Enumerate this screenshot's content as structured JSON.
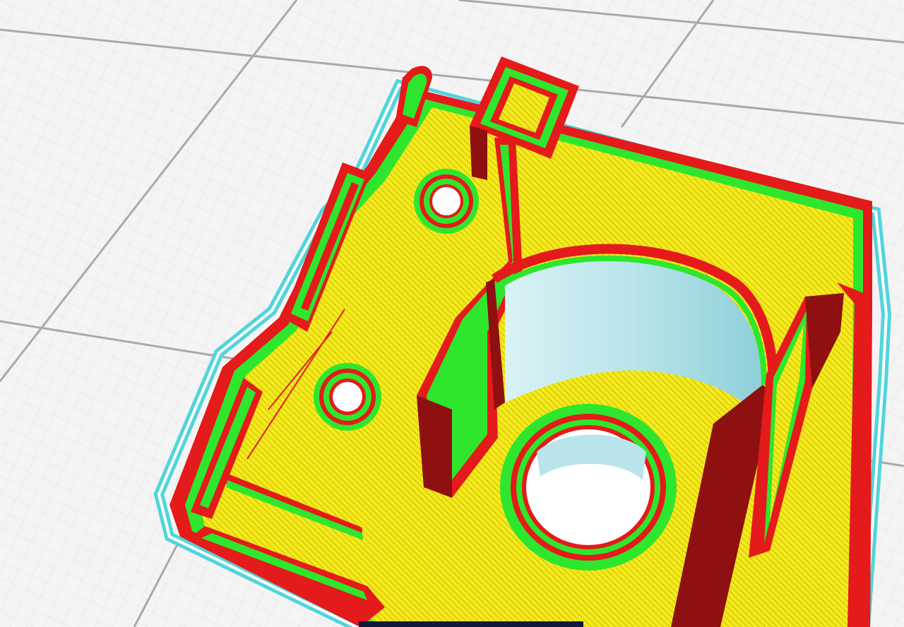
{
  "viewport": {
    "kind": "slicer-layer-preview",
    "background_color": "#f4f4f4",
    "grid": {
      "minor_color": "#e2e2e2",
      "major_color": "#a9a9a9",
      "visible": true
    }
  },
  "colors": {
    "skirt": "#52d4dc",
    "outer_wall": "#e51a1a",
    "outer_wall_shadow": "#8f1010",
    "inner_wall": "#2ee62e",
    "infill": "#f4ea1c",
    "infill_line": "#b9a800",
    "support_cylinder": "#b8e4ea",
    "hole_background": "#ffffff",
    "bottom_toolbar": "#101a3c"
  },
  "layer_features": [
    {
      "name": "skirt",
      "icon": "skirt-outline-icon"
    },
    {
      "name": "outer-wall",
      "icon": "outer-wall-icon"
    },
    {
      "name": "inner-wall",
      "icon": "inner-wall-icon"
    },
    {
      "name": "infill",
      "icon": "infill-icon"
    }
  ]
}
